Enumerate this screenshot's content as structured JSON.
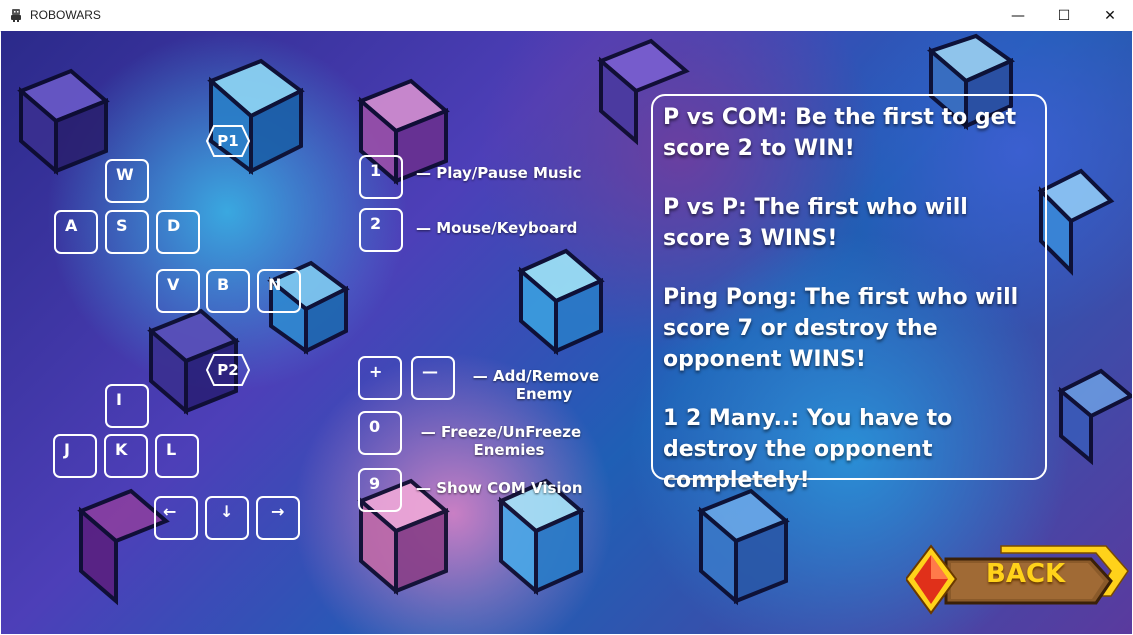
{
  "window": {
    "title": "ROBOWARS",
    "minimize_glyph": "—",
    "maximize_glyph": "☐",
    "close_glyph": "✕"
  },
  "players": {
    "p1": {
      "badge": "P1",
      "keys": [
        "W",
        "A",
        "S",
        "D",
        "V",
        "B",
        "N"
      ]
    },
    "p2": {
      "badge": "P2",
      "keys": [
        "I",
        "J",
        "K",
        "L",
        "←",
        "↓",
        "→"
      ]
    }
  },
  "shortcuts": [
    {
      "keys": [
        "1"
      ],
      "description": "— Play/Pause Music"
    },
    {
      "keys": [
        "2"
      ],
      "description": "— Mouse/Keyboard"
    },
    {
      "keys": [
        "+",
        "—"
      ],
      "description_lines": [
        "— Add/Remove",
        "Enemy"
      ]
    },
    {
      "keys": [
        "0"
      ],
      "description_lines": [
        "— Freeze/UnFreeze",
        "Enemies"
      ]
    },
    {
      "keys": [
        "9"
      ],
      "description": "— Show COM Vision"
    }
  ],
  "rules": [
    "P vs COM: Be the first to get score 2 to WIN!",
    "P vs P: The first who will score 3 WINS!",
    "Ping Pong: The first who will score 7 or destroy the opponent WINS!",
    "1 2 Many..: You have to destroy the opponent completely!"
  ],
  "back_button": {
    "label": "BACK"
  },
  "colors": {
    "accent_gold": "#ffd21a",
    "button_brown": "#8a5a2a",
    "gem_red": "#e0301a"
  }
}
